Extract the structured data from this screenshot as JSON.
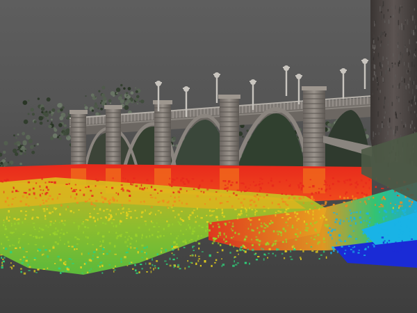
{
  "scene": {
    "subject": "point-cloud-bridge-scan",
    "background_color": "#555555",
    "colormap": [
      "#1a2bd6",
      "#19b3e6",
      "#2fd17a",
      "#9ad22a",
      "#e6d21e",
      "#f08a1e",
      "#e8291c"
    ],
    "structure_color": "#8a8480",
    "foliage_color": "#3e4a38"
  }
}
